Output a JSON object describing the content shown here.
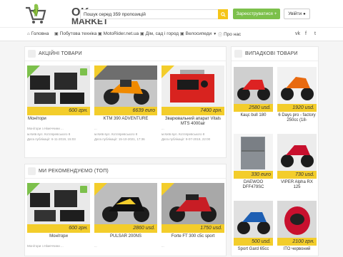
{
  "brand": {
    "line1": "OK",
    "line2": "MARKET"
  },
  "search": {
    "value": "Пошук серед  359 пропозицій"
  },
  "header": {
    "add_label": "Зареєструватися",
    "login_label": "Увійти"
  },
  "nav": {
    "items": [
      {
        "label": "Головна",
        "icon": "home-icon"
      },
      {
        "label": "Побутова техніка",
        "icon": "folder-icon"
      },
      {
        "label": "MotoRider.net.ua",
        "icon": "folder-icon"
      },
      {
        "label": "Дім, сад і город",
        "icon": "folder-icon"
      },
      {
        "label": "Велосипеди",
        "icon": "folder-icon"
      },
      {
        "label": "Про нас",
        "icon": "info-icon"
      }
    ],
    "social": [
      "vk",
      "f",
      "t"
    ]
  },
  "sections": {
    "actions_title": "АКЦІЙНІ ТОВАРИ",
    "recommended_title": "МИ РЕКОМЕНДУЄМО (ТОП)",
    "featured_title": "ВИПАДКОВІ ТОВАРИ"
  },
  "actions": [
    {
      "price": "600 грн.",
      "title": "Монітори",
      "user": "Монітори з Німеччини ...",
      "addr": "м.Київ вул. Котляревського 8",
      "date": "Дата публікації: 6-11-2019, 15:03"
    },
    {
      "price": "6639 euro",
      "title": "KTM 390 ADVENTURE",
      "user": "...",
      "addr": "м.Київ вул. Котляревського 8",
      "date": "Дата публікації: 15-10-2021, 17:36"
    },
    {
      "price": "7400 грн.",
      "title": "Зварювальний апарат Vitals MTS 4000air",
      "user": "...",
      "addr": "м.Київ вул. Котляревського 8",
      "date": "Дата публікації: 9-07-2019, 22:00"
    }
  ],
  "recommended": [
    {
      "price": "600 грн.",
      "title": "Монітори",
      "user": "Монітори з Німеччини ..."
    },
    {
      "price": "2860 usd.",
      "title": "PULSAR 200NS",
      "user": "..."
    },
    {
      "price": "1750 usd.",
      "title": "Forte FT 300 c5c sport",
      "user": "..."
    }
  ],
  "featured": [
    {
      "price": "2580 usd.",
      "title": "Кацс bull 180"
    },
    {
      "price": "1920 usd.",
      "title": "6 Days pro - factory 250cc (18-"
    },
    {
      "price": "330 euro",
      "title": "DAEWOO DFF479SC"
    },
    {
      "price": "730 usd.",
      "title": "VIPER Alpha RX 125"
    },
    {
      "price": "500 usd.",
      "title": "Sport Gard 65cc"
    },
    {
      "price": "2100 грн.",
      "title": "ITO червоний"
    }
  ],
  "colors": {
    "accent": "#f3cd2b",
    "green": "#7cc04b"
  }
}
